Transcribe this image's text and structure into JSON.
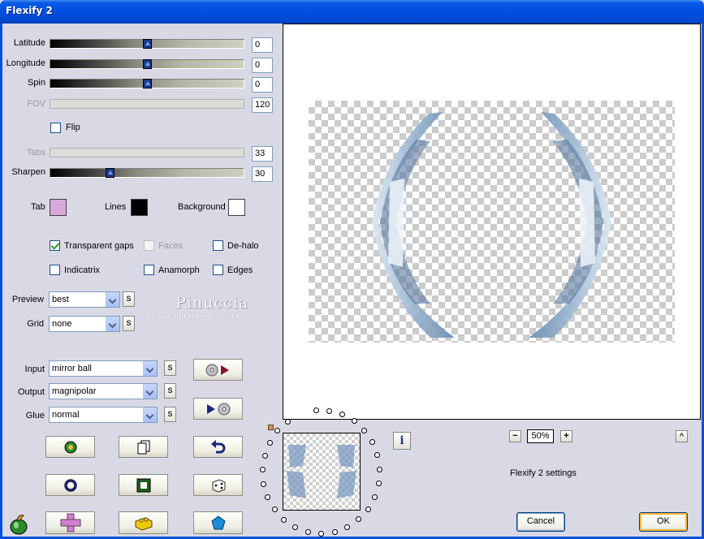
{
  "window": {
    "title": "Flexify 2"
  },
  "sliders": [
    {
      "label": "Latitude",
      "value": "0",
      "fraction": 0.5,
      "enabled": true
    },
    {
      "label": "Longitude",
      "value": "0",
      "fraction": 0.5,
      "enabled": true
    },
    {
      "label": "Spin",
      "value": "0",
      "fraction": 0.5,
      "enabled": true
    },
    {
      "label": "FOV",
      "value": "120",
      "enabled": false
    },
    {
      "label": "Tabs",
      "value": "33",
      "enabled": false
    },
    {
      "label": "Sharpen",
      "value": "30",
      "fraction": 0.3,
      "enabled": true
    }
  ],
  "flip": {
    "label": "Flip",
    "checked": false
  },
  "colors": {
    "tab": {
      "label": "Tab",
      "color": "#d8a8d8"
    },
    "lines": {
      "label": "Lines",
      "color": "#000000"
    },
    "background": {
      "label": "Background",
      "color": "#ffffff"
    }
  },
  "options": {
    "transparent_gaps": {
      "label": "Transparent gaps",
      "checked": true
    },
    "faces": {
      "label": "Faces",
      "checked": false,
      "enabled": false
    },
    "de_halo": {
      "label": "De-halo",
      "checked": false
    },
    "indicatrix": {
      "label": "Indicatrix",
      "checked": false
    },
    "anamorph": {
      "label": "Anamorph",
      "checked": false
    },
    "edges": {
      "label": "Edges",
      "checked": false
    }
  },
  "preview": {
    "label": "Preview",
    "value": "best"
  },
  "grid": {
    "label": "Grid",
    "value": "none"
  },
  "input": {
    "label": "Input",
    "value": "mirror ball"
  },
  "output": {
    "label": "Output",
    "value": "magnipolar"
  },
  "glue": {
    "label": "Glue",
    "value": "normal"
  },
  "s_button_label": "S",
  "watermark": {
    "name": "Pinuccia",
    "site": "www.maidiregrafica.eu"
  },
  "zoom": {
    "minus": "−",
    "value": "50%",
    "plus": "+"
  },
  "settings_caption": "Flexify 2 settings",
  "info_label": "i",
  "scroll_up_label": "^",
  "buttons": {
    "cancel": "Cancel",
    "ok": "OK"
  }
}
